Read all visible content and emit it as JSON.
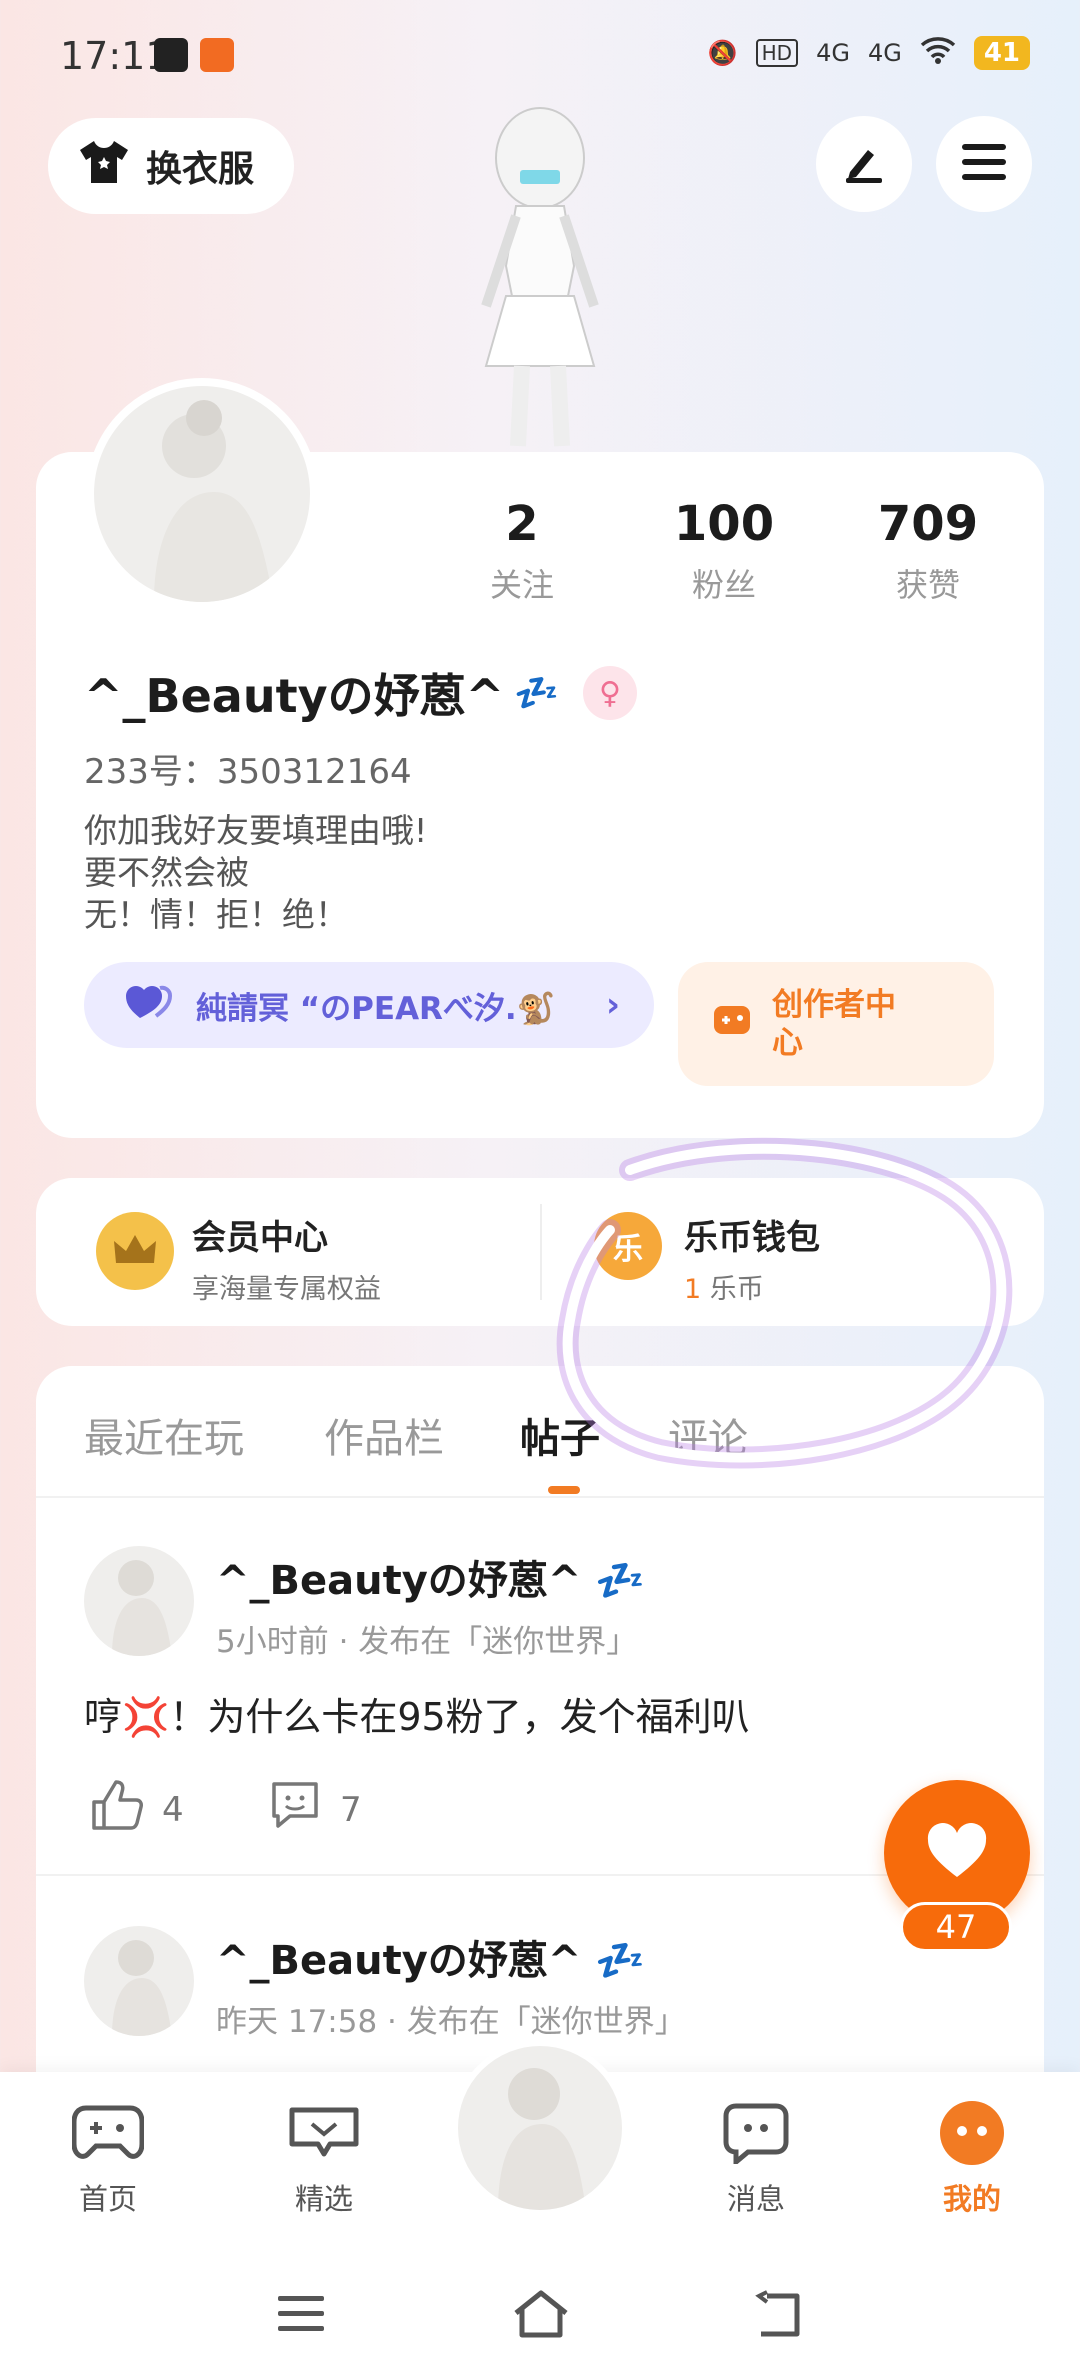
{
  "status_bar": {
    "time": "17:11",
    "signal_1": "4G",
    "signal_2": "4G",
    "battery": "41"
  },
  "header": {
    "outfit_label": "换衣服"
  },
  "profile": {
    "stats": [
      {
        "value": "2",
        "label": "关注"
      },
      {
        "value": "100",
        "label": "粉丝"
      },
      {
        "value": "709",
        "label": "获赞"
      }
    ],
    "username": "^_Beautyの妤蒽^",
    "id_text": "233号：350312164",
    "bio": [
      "你加我好友要填理由哦!",
      "要不然会被",
      "无！情！拒！绝！"
    ],
    "group_label": "純請冥 “のPEARべ汐.🐒",
    "creator_label_line1": "创作者中",
    "creator_label_line2": "心"
  },
  "wallet_row": {
    "member_title": "会员中心",
    "member_sub": "享海量专属权益",
    "coin_icon_text": "乐",
    "wallet_title": "乐币钱包",
    "wallet_amount": "1",
    "wallet_unit": "乐币"
  },
  "tabs": [
    "最近在玩",
    "作品栏",
    "帖子",
    "评论"
  ],
  "active_tab": "帖子",
  "posts": [
    {
      "author": "^_Beautyの妤蒽^",
      "meta": "5小时前 · 发布在「迷你世界」",
      "text": "哼💢！为什么卡在95粉了，发个福利叭",
      "likes": "4",
      "comments": "7"
    },
    {
      "author": "^_Beautyの妤蒽^",
      "meta": "昨天 17:58 · 发布在「迷你世界」"
    }
  ],
  "fab": {
    "count": "47"
  },
  "bottom_nav": [
    {
      "label": "首页",
      "icon": "gamepad-icon"
    },
    {
      "label": "精选",
      "icon": "heart-chat-icon"
    },
    {
      "label": "消息",
      "icon": "message-icon"
    },
    {
      "label": "我的",
      "icon": "face-icon"
    }
  ],
  "colors": {
    "accent": "#f27b23",
    "fab": "#f76b0b",
    "group": "#6360d9",
    "annotation": "#b77be6"
  }
}
